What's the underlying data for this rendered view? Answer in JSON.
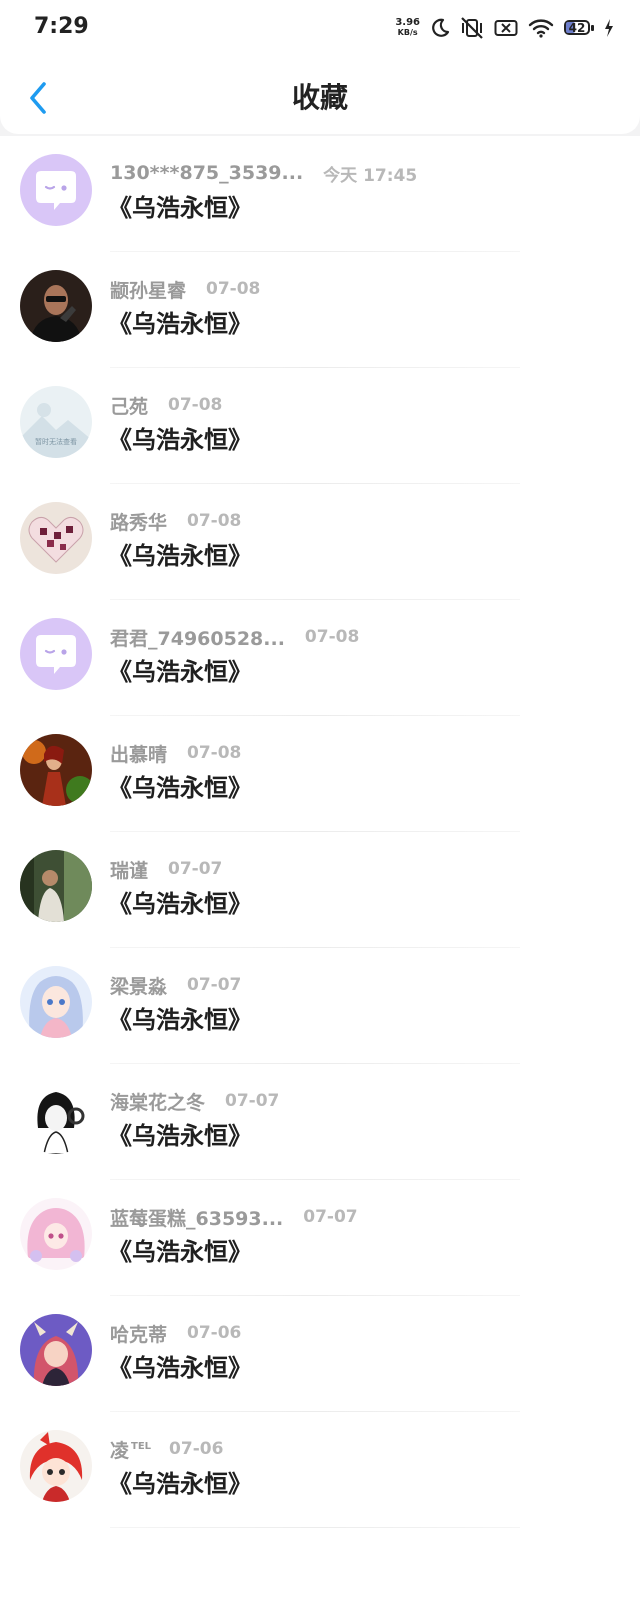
{
  "status_bar": {
    "time": "7:29",
    "net_speed_value": "3.96",
    "net_speed_unit": "KB/s",
    "battery_level": "42",
    "icons": [
      "moon-icon",
      "vibrate-off-icon",
      "no-sim-icon",
      "wifi-icon",
      "battery-icon",
      "charging-bolt-icon"
    ]
  },
  "header": {
    "back_icon": "chevron-left-icon",
    "title": "收藏",
    "accent_color": "#1e9bf0"
  },
  "favorites": [
    {
      "username": "130***875_3539...",
      "superscript": "",
      "date": "今天 17:45",
      "title": "《乌浩永恒》",
      "avatar": "default-chat-avatar"
    },
    {
      "username": "颛孙星睿",
      "superscript": "",
      "date": "07-08",
      "title": "《乌浩永恒》",
      "avatar": "gunman-avatar"
    },
    {
      "username": "己苑",
      "superscript": "",
      "date": "07-08",
      "title": "《乌浩永恒》",
      "avatar": "image-unavailable-avatar"
    },
    {
      "username": "路秀华",
      "superscript": "",
      "date": "07-08",
      "title": "《乌浩永恒》",
      "avatar": "puzzle-heart-avatar"
    },
    {
      "username": "君君_74960528...",
      "superscript": "",
      "date": "07-08",
      "title": "《乌浩永恒》",
      "avatar": "default-chat-avatar"
    },
    {
      "username": "出慕晴",
      "superscript": "",
      "date": "07-08",
      "title": "《乌浩永恒》",
      "avatar": "fantasy-warrior-avatar"
    },
    {
      "username": "瑞谨",
      "superscript": "",
      "date": "07-07",
      "title": "《乌浩永恒》",
      "avatar": "forest-person-avatar"
    },
    {
      "username": "梁景淼",
      "superscript": "",
      "date": "07-07",
      "title": "《乌浩永恒》",
      "avatar": "anime-girl-avatar"
    },
    {
      "username": "海棠花之冬",
      "superscript": "",
      "date": "07-07",
      "title": "《乌浩永恒》",
      "avatar": "headphone-girl-avatar"
    },
    {
      "username": "蓝莓蛋糕_63593...",
      "superscript": "",
      "date": "07-07",
      "title": "《乌浩永恒》",
      "avatar": "pink-anime-avatar"
    },
    {
      "username": "哈克蒂",
      "superscript": "",
      "date": "07-06",
      "title": "《乌浩永恒》",
      "avatar": "horned-girl-avatar"
    },
    {
      "username": "凌",
      "superscript": "TEL",
      "date": "07-06",
      "title": "《乌浩永恒》",
      "avatar": "red-hair-chibi-avatar"
    }
  ],
  "avatar_overlay_text": "暂时无法查看",
  "colors": {
    "username": "#9a9a9a",
    "date": "#b8b8b8",
    "title": "#1f1f1f",
    "default_avatar_bg": "#d9c6f7"
  }
}
